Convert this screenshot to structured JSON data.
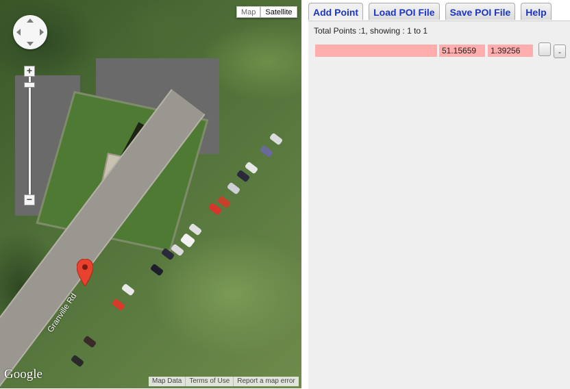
{
  "map": {
    "type_buttons": [
      {
        "label": "Map",
        "active": false
      },
      {
        "label": "Satellite",
        "active": true
      }
    ],
    "zoom": {
      "in_label": "+",
      "out_label": "−",
      "level_fraction": 0.05
    },
    "road_label": "Granville Rd",
    "logo": "Google",
    "attribution": [
      "Map Data",
      "Terms of Use",
      "Report a map error"
    ],
    "marker_color": "#e8412e",
    "icons": [
      "pan-control-icon",
      "map-marker-icon"
    ]
  },
  "panel": {
    "tabs": [
      {
        "label": "Add Point"
      },
      {
        "label": "Load POI File"
      },
      {
        "label": "Save POI File"
      },
      {
        "label": "Help"
      }
    ],
    "total_info": "Total Points :1, showing : 1 to 1",
    "points": [
      {
        "name": "",
        "lat": "51.15659",
        "lon": "1.39256",
        "btn1": "",
        "btn2": "-"
      }
    ],
    "row_color": "#ffadad",
    "tab_text_color": "#1a34c4"
  }
}
